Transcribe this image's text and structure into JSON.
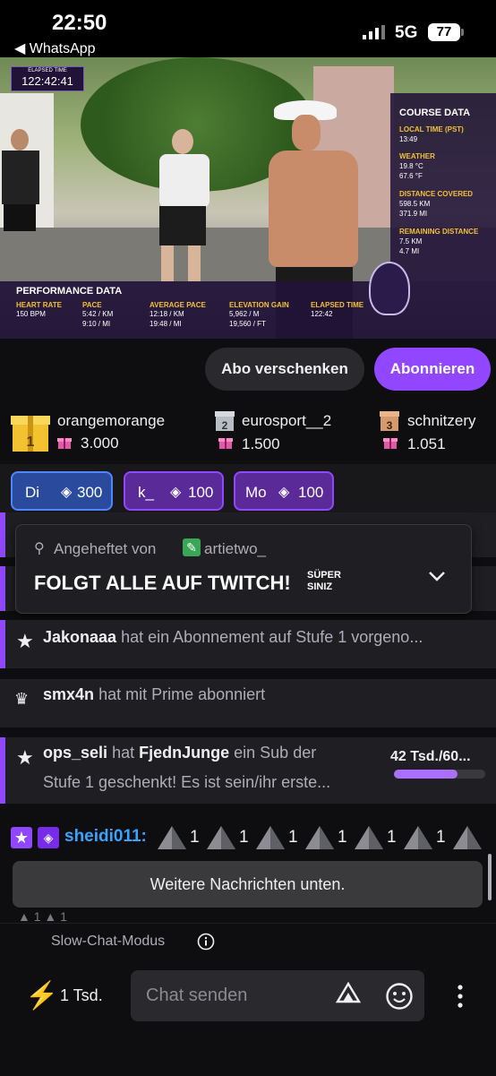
{
  "status_bar": {
    "time": "22:50",
    "back_label": "◀ WhatsApp",
    "network": "5G",
    "battery": "77"
  },
  "video": {
    "elapsed_label": "ELAPSED TIME",
    "elapsed_value": "122:42:41",
    "course": {
      "title": "COURSE DATA",
      "local_time_label": "LOCAL TIME (PST)",
      "local_time": "13:49",
      "weather_label": "WEATHER",
      "weather_c": "19.8 °C",
      "weather_f": "67.6 °F",
      "distance_label": "DISTANCE COVERED",
      "distance_km": "598.5 KM",
      "distance_mi": "371.9 MI",
      "remaining_label": "REMAINING DISTANCE",
      "remaining_km": "7.5 KM",
      "remaining_mi": "4.7 MI"
    },
    "performance": {
      "title": "PERFORMANCE DATA",
      "heart_label": "HEART RATE",
      "heart": "150 BPM",
      "pace_label": "PACE",
      "pace_km": "5:42   /   KM",
      "pace_mi": "9:10   /   MI",
      "avg_label": "AVERAGE PACE",
      "avg_km": "12:18   /   KM",
      "avg_mi": "19:48   /   MI",
      "elev_label": "ELEVATION GAIN",
      "elev_m": "5,962   /   M",
      "elev_ft": "19,560   /   FT",
      "elapsed_label": "ELAPSED TIME",
      "elapsed": "122:42"
    }
  },
  "actions": {
    "gift_label": "Abo verschenken",
    "subscribe_label": "Abonnieren"
  },
  "leaderboard": [
    {
      "rank": "1",
      "name": "orangemorange",
      "count": "3.000"
    },
    {
      "rank": "2",
      "name": "eurosport__2",
      "count": "1.500"
    },
    {
      "rank": "3",
      "name": "schnitzery",
      "count": "1.051"
    }
  ],
  "predictions": [
    {
      "label": "Di",
      "points": "300"
    },
    {
      "label": "k_",
      "points": "100"
    },
    {
      "label": "Mo",
      "points": "100"
    }
  ],
  "pinned": {
    "by_prefix": "Angeheftet von",
    "by_user": "artietwo_",
    "message": "FOLGT ALLE AUF TWITCH!",
    "emote_line1": "SÜPER",
    "emote_line2": "SINIZ"
  },
  "events": [
    {
      "user": "Jakonaaa",
      "text": "hat ein Abonnement auf Stufe 1 vorgeno..."
    },
    {
      "user": "smx4n",
      "text": "hat mit Prime abonniert"
    },
    {
      "user": "ops_seli",
      "text_a": "hat",
      "user2": "FjednJunge",
      "text_b": "ein Sub der",
      "text_line2": "Stufe 1 geschenkt! Es ist sein/ihr erste...",
      "goal": "42 Tsd./60...",
      "goal_fraction": 0.7
    }
  ],
  "chat_line": {
    "user": "sheidi011:",
    "counts": [
      "1",
      "1",
      "1",
      "1",
      "1",
      "1"
    ]
  },
  "more_messages": "Weitere Nachrichten unten.",
  "bottom": {
    "slow_mode": "Slow-Chat-Modus",
    "bits": "1 Tsd.",
    "chat_placeholder": "Chat senden"
  },
  "colors": {
    "accent": "#9147ff",
    "background": "#0e0e10",
    "gold": "#f2c230"
  }
}
